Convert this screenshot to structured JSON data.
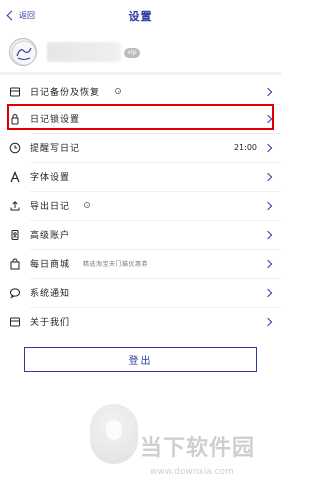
{
  "header": {
    "back_label": "返回",
    "title": "设置"
  },
  "profile": {
    "vip_badge": "vip"
  },
  "settings": {
    "items": [
      {
        "label": "日记备份及恢复",
        "icon": "backup-icon",
        "has_dot": true
      },
      {
        "label": "日记锁设置",
        "icon": "lock-icon",
        "highlighted": true
      },
      {
        "label": "提醒写日记",
        "icon": "clock-icon",
        "value": "21:00"
      },
      {
        "label": "字体设置",
        "icon": "font-icon"
      },
      {
        "label": "导出日记",
        "icon": "export-icon",
        "has_dot": true
      },
      {
        "label": "高级账户",
        "icon": "account-icon"
      },
      {
        "label": "每日商城",
        "icon": "shop-icon",
        "hint": "精选淘宝天门猫优惠券"
      },
      {
        "label": "系统通知",
        "icon": "message-icon"
      },
      {
        "label": "关于我们",
        "icon": "about-icon"
      }
    ]
  },
  "logout": {
    "label": "登出"
  },
  "watermark": {
    "brand": "当下软件园",
    "url": "www.downxia.com"
  },
  "colors": {
    "accent": "#2f3a9e",
    "highlight_border": "#e00000"
  }
}
